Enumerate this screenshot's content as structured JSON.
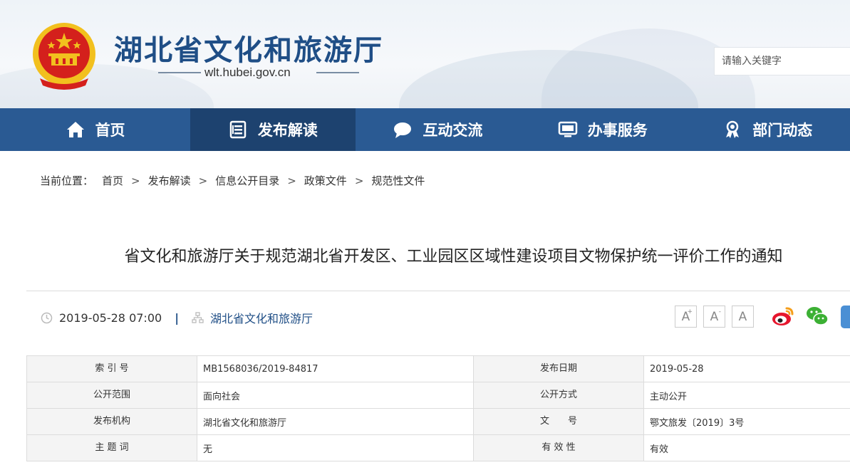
{
  "header": {
    "site_title": "湖北省文化和旅游厅",
    "site_domain": "wlt.hubei.gov.cn",
    "search_placeholder": "请输入关键字"
  },
  "nav": {
    "items": [
      {
        "label": "首页",
        "icon": "home-icon"
      },
      {
        "label": "发布解读",
        "icon": "document-list-icon",
        "active": true
      },
      {
        "label": "互动交流",
        "icon": "chat-bubble-icon"
      },
      {
        "label": "办事服务",
        "icon": "monitor-icon"
      },
      {
        "label": "部门动态",
        "icon": "award-ribbon-icon"
      }
    ]
  },
  "breadcrumb": {
    "prefix": "当前位置：",
    "items": [
      "首页",
      "发布解读",
      "信息公开目录",
      "政策文件",
      "规范性文件"
    ],
    "separator": ">"
  },
  "article": {
    "title": "省文化和旅游厅关于规范湖北省开发区、工业园区区域性建设项目文物保护统一评价工作的通知",
    "datetime": "2019-05-28 07:00",
    "divider": "|",
    "publisher": "湖北省文化和旅游厅"
  },
  "font_controls": {
    "increase_label": "A",
    "increase_sup": "+",
    "decrease_label": "A",
    "decrease_sup": "-",
    "reset_label": "A"
  },
  "share": {
    "weibo_icon": "weibo-icon",
    "wechat_icon": "wechat-icon"
  },
  "info_table": {
    "rows": [
      {
        "label1": "索 引 号",
        "value1": "MB1568036/2019-84817",
        "label2": "发布日期",
        "value2": "2019-05-28"
      },
      {
        "label1": "公开范围",
        "value1": "面向社会",
        "label2": "公开方式",
        "value2": "主动公开"
      },
      {
        "label1": "发布机构",
        "value1": "湖北省文化和旅游厅",
        "label2": "文　　号",
        "value2": "鄂文旅发〔2019〕3号"
      },
      {
        "label1": "主 题 词",
        "value1": "无",
        "label2": "有 效 性",
        "value2": "有效"
      }
    ]
  },
  "colors": {
    "nav_bg": "#2a5a93",
    "nav_active": "#1d426f",
    "title_blue": "#1f4e86",
    "emblem_red": "#d4201c",
    "emblem_gold": "#f2c01e"
  }
}
